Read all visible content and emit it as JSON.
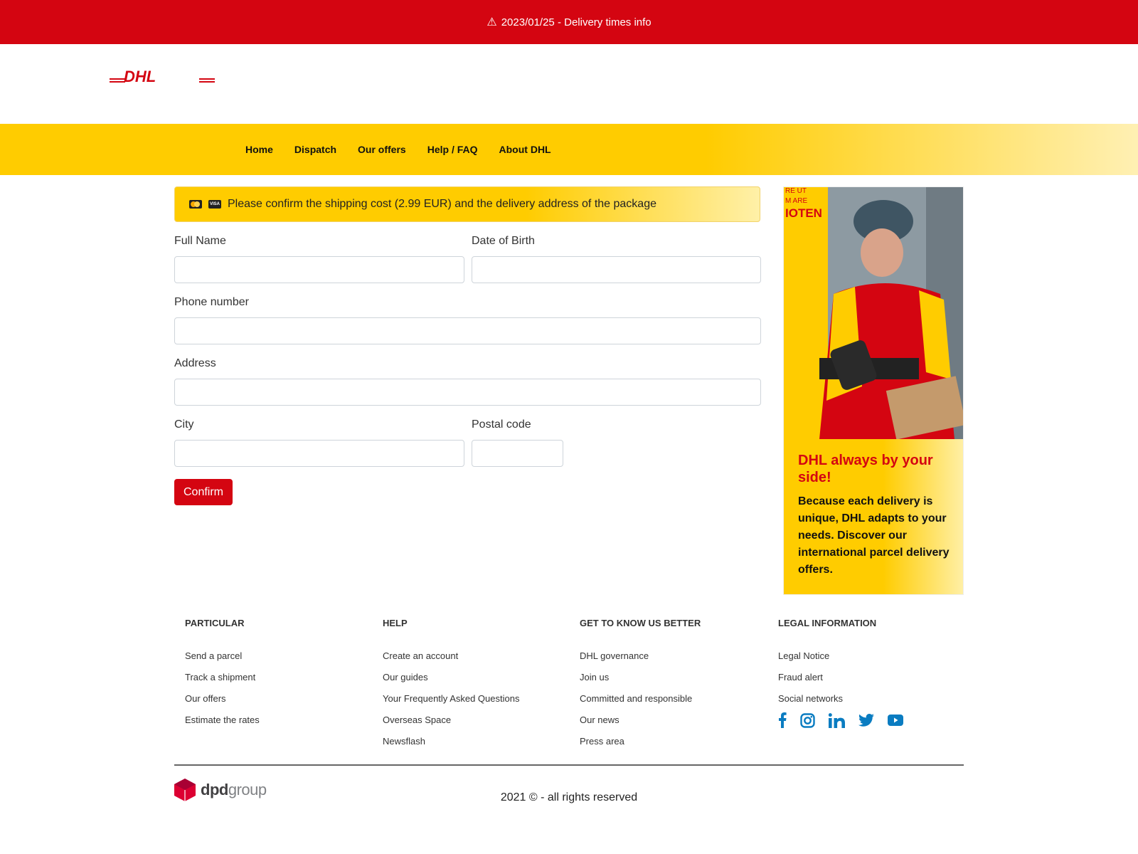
{
  "topbar": {
    "text": "2023/01/25 - Delivery times info"
  },
  "brand": {
    "logo_text": "DHL",
    "logo_color": "#d40511",
    "accent_yellow": "#ffcc00"
  },
  "nav": {
    "items": [
      "Home",
      "Dispatch",
      "Our offers",
      "Help / FAQ",
      "About DHL"
    ]
  },
  "notice": {
    "text": "Please confirm the shipping cost (2.99 EUR) and the delivery address of the package",
    "card_icons": [
      "mastercard-icon",
      "visa-icon"
    ],
    "visa_text": "VISA"
  },
  "form": {
    "full_name_label": "Full Name",
    "dob_label": "Date of Birth",
    "phone_label": "Phone number",
    "address_label": "Address",
    "city_label": "City",
    "postal_label": "Postal code",
    "full_name_value": "",
    "dob_value": "",
    "phone_value": "",
    "address_value": "",
    "city_value": "",
    "postal_value": "",
    "confirm_label": "Confirm"
  },
  "promo": {
    "title": "DHL always by your side!",
    "body": "Because each delivery is unique, DHL adapts to your needs. Discover our international parcel delivery offers.",
    "image_fragment_lines": [
      "RE UT",
      "M ARE",
      "IOTEN"
    ]
  },
  "footer": {
    "columns": [
      {
        "heading": "PARTICULAR",
        "links": [
          "Send a parcel",
          "Track a shipment",
          "Our offers",
          "Estimate the rates"
        ]
      },
      {
        "heading": "HELP",
        "links": [
          "Create an account",
          "Our guides",
          "Your Frequently Asked Questions",
          "Overseas Space",
          "Newsflash"
        ]
      },
      {
        "heading": "GET TO KNOW US BETTER",
        "links": [
          "DHL governance",
          "Join us",
          "Committed and responsible",
          "Our news",
          "Press area"
        ]
      },
      {
        "heading": "LEGAL INFORMATION",
        "links": [
          "Legal Notice",
          "Fraud alert",
          "Social networks"
        ]
      }
    ],
    "social_icons": [
      "facebook-icon",
      "instagram-icon",
      "linkedin-icon",
      "twitter-icon",
      "youtube-icon"
    ],
    "social_color": "#0a7cc1",
    "dpd_logo": {
      "dpd": "dpd",
      "group": "group"
    },
    "copyright": "2021 © - all rights reserved"
  }
}
